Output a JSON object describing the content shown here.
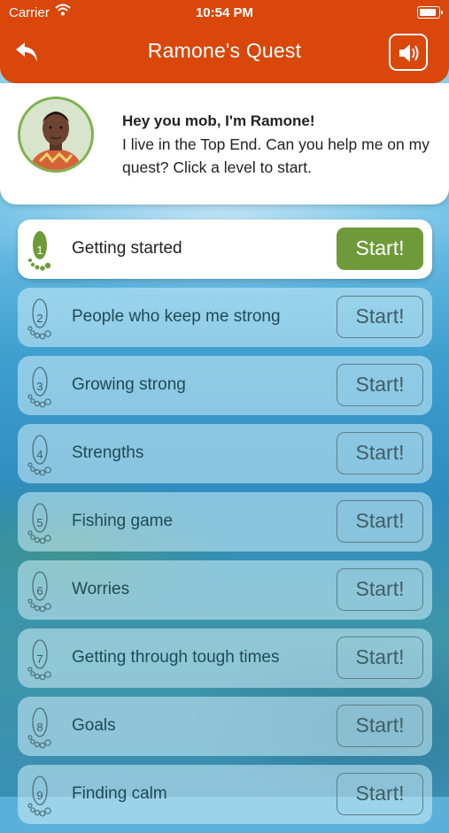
{
  "status_bar": {
    "carrier": "Carrier",
    "time": "10:54 PM"
  },
  "header": {
    "title": "Ramone's Quest"
  },
  "intro": {
    "greeting": "Hey you mob, I'm Ramone!",
    "message": "I live in the Top End. Can you help me on my quest? Click a level to start."
  },
  "levels": [
    {
      "number": "1",
      "label": "Getting started",
      "button": "Start!"
    },
    {
      "number": "2",
      "label": "People who keep me strong",
      "button": "Start!"
    },
    {
      "number": "3",
      "label": "Growing strong",
      "button": "Start!"
    },
    {
      "number": "4",
      "label": "Strengths",
      "button": "Start!"
    },
    {
      "number": "5",
      "label": "Fishing game",
      "button": "Start!"
    },
    {
      "number": "6",
      "label": "Worries",
      "button": "Start!"
    },
    {
      "number": "7",
      "label": "Getting through tough times",
      "button": "Start!"
    },
    {
      "number": "8",
      "label": "Goals",
      "button": "Start!"
    },
    {
      "number": "9",
      "label": "Finding calm",
      "button": "Start!"
    }
  ],
  "colors": {
    "header": "#d9470b",
    "active_button": "#6f9a3a",
    "foot_active": "#6f9a3a"
  }
}
